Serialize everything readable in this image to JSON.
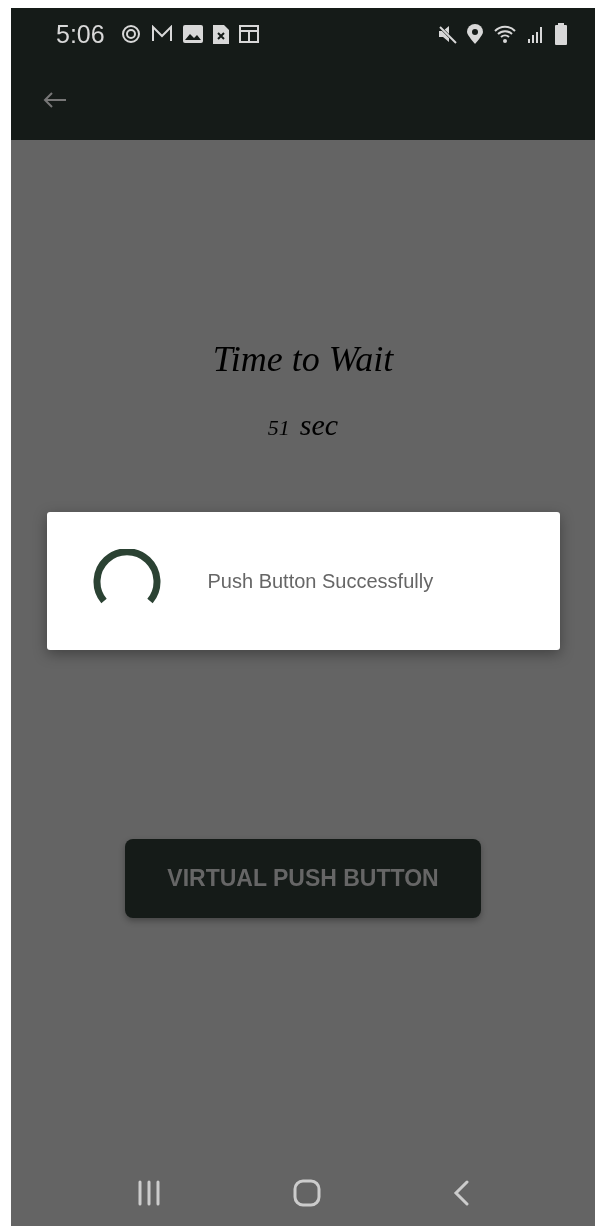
{
  "status_bar": {
    "time": "5:06"
  },
  "screen": {
    "title": "Time to Wait",
    "countdown": {
      "number": "51",
      "unit": "sec"
    }
  },
  "dialog": {
    "message": "Push Button Successfully",
    "loading": true
  },
  "button": {
    "label": "VIRTUAL PUSH BUTTON"
  }
}
